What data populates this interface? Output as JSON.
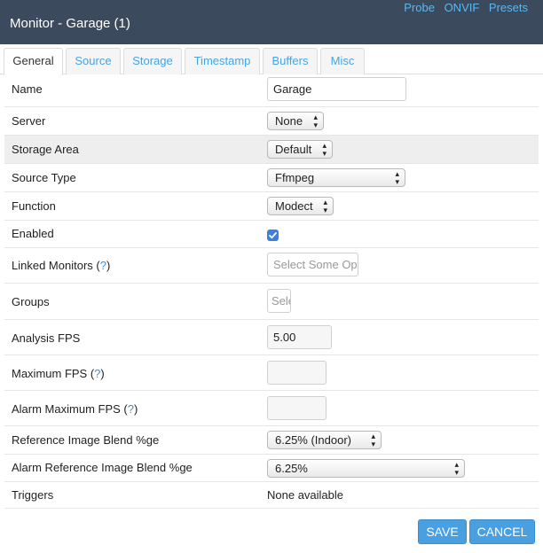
{
  "window": {
    "title": "Monitor - Garage (1)"
  },
  "header_links": [
    "Probe",
    "ONVIF",
    "Presets"
  ],
  "tabs": [
    {
      "label": "General",
      "active": true
    },
    {
      "label": "Source",
      "active": false
    },
    {
      "label": "Storage",
      "active": false
    },
    {
      "label": "Timestamp",
      "active": false
    },
    {
      "label": "Buffers",
      "active": false
    },
    {
      "label": "Misc",
      "active": false
    }
  ],
  "form": {
    "name": {
      "label": "Name",
      "value": "Garage"
    },
    "server": {
      "label": "Server",
      "value": "None"
    },
    "storage_area": {
      "label": "Storage Area",
      "value": "Default"
    },
    "source_type": {
      "label": "Source Type",
      "value": "Ffmpeg"
    },
    "function": {
      "label": "Function",
      "value": "Modect"
    },
    "enabled": {
      "label": "Enabled",
      "checked": true
    },
    "linked_monitors": {
      "label": "Linked Monitors (",
      "help": "?",
      "close": ")",
      "placeholder": "Select Some Options"
    },
    "groups": {
      "label": "Groups",
      "placeholder": "Select Some Options"
    },
    "analysis_fps": {
      "label": "Analysis FPS",
      "value": "5.00"
    },
    "maximum_fps": {
      "label": "Maximum FPS (",
      "help": "?",
      "close": ")",
      "value": ""
    },
    "alarm_maximum_fps": {
      "label": "Alarm Maximum FPS (",
      "help": "?",
      "close": ")",
      "value": ""
    },
    "reference_blend": {
      "label": "Reference Image Blend %ge",
      "value": "6.25% (Indoor)"
    },
    "alarm_reference_blend": {
      "label": "Alarm Reference Image Blend %ge",
      "value": "6.25%"
    },
    "triggers": {
      "label": "Triggers",
      "value": "None available"
    }
  },
  "buttons": {
    "save": "SAVE",
    "cancel": "CANCEL"
  },
  "colors": {
    "titlebar": "#3c4a5e",
    "link": "#5bb8ef",
    "button": "#4a9fe1",
    "checkbox": "#3b7fe0"
  }
}
